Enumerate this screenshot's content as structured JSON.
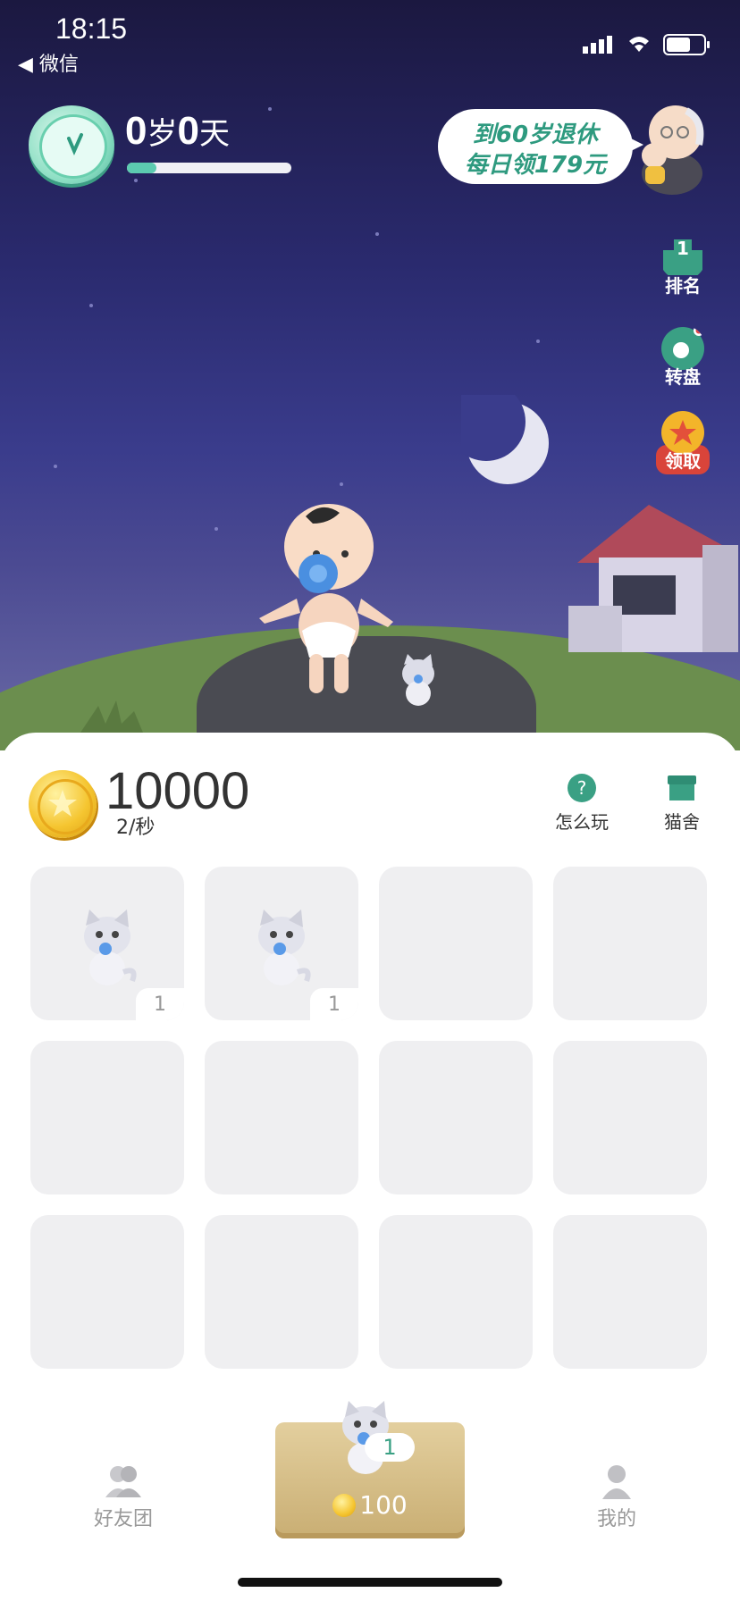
{
  "status_bar": {
    "time": "18:15",
    "back_label": "微信"
  },
  "header": {
    "age_years": "0",
    "age_years_unit": "岁",
    "age_days": "0",
    "age_days_unit": "天",
    "age_progress_fraction": 0.18,
    "retire_bubble": {
      "line1": "到60岁退休",
      "line2": "每日领179元"
    }
  },
  "side_menu": [
    {
      "label": "排名",
      "badge": "1",
      "icon": "ranking-icon"
    },
    {
      "label": "转盘",
      "icon": "wheel-icon"
    },
    {
      "label": "领取",
      "icon": "star-medal-icon"
    }
  ],
  "wallet": {
    "coins": "10000",
    "rate": "2/秒"
  },
  "tools": [
    {
      "label": "怎么玩",
      "icon": "question-icon"
    },
    {
      "label": "猫舍",
      "icon": "cat-house-icon"
    }
  ],
  "grid": [
    {
      "has_cat": true,
      "level": "1"
    },
    {
      "has_cat": true,
      "level": "1"
    },
    {
      "has_cat": false
    },
    {
      "has_cat": false
    },
    {
      "has_cat": false
    },
    {
      "has_cat": false
    },
    {
      "has_cat": false
    },
    {
      "has_cat": false
    },
    {
      "has_cat": false
    },
    {
      "has_cat": false
    },
    {
      "has_cat": false
    },
    {
      "has_cat": false
    }
  ],
  "tabbar": {
    "friends_label": "好友团",
    "buy_level": "1",
    "buy_price": "100",
    "mine_label": "我的"
  },
  "colors": {
    "accent": "#3aa084",
    "sky_top": "#1b1840",
    "grass": "#6b8e4e"
  }
}
